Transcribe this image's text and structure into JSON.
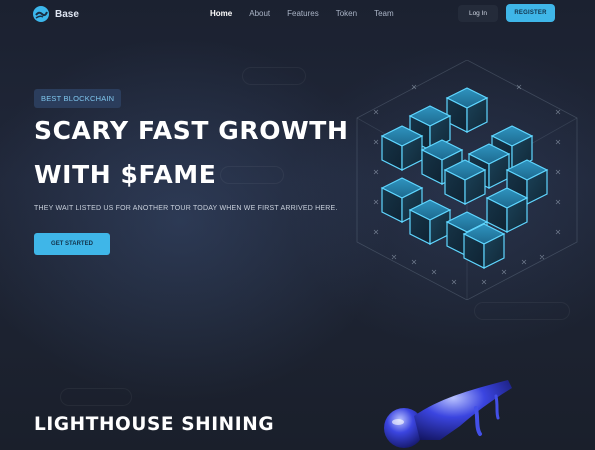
{
  "brand": {
    "name": "Base"
  },
  "nav": {
    "links": [
      "Home",
      "About",
      "Features",
      "Token",
      "Team"
    ],
    "active": "Home",
    "login_label": "Log In",
    "register_label": "REGISTER"
  },
  "hero": {
    "badge": "BEST BLOCKCHAIN",
    "title_line1": "SCARY FAST GROWTH",
    "title_line2": "WITH $FAME",
    "subtitle": "THEY WAIT LISTED US FOR ANOTHER TOUR TODAY WHEN WE FIRST ARRIVED HERE.",
    "cta_label": "GET STARTED"
  },
  "section2": {
    "title": "LIGHTHOUSE SHINING"
  },
  "colors": {
    "accent": "#3fb6e8",
    "background": "#1d2333",
    "badge_bg": "#2b3d5c"
  },
  "icons": [
    "logo-icon",
    "cube-illustration",
    "liquid-blob-illustration"
  ]
}
